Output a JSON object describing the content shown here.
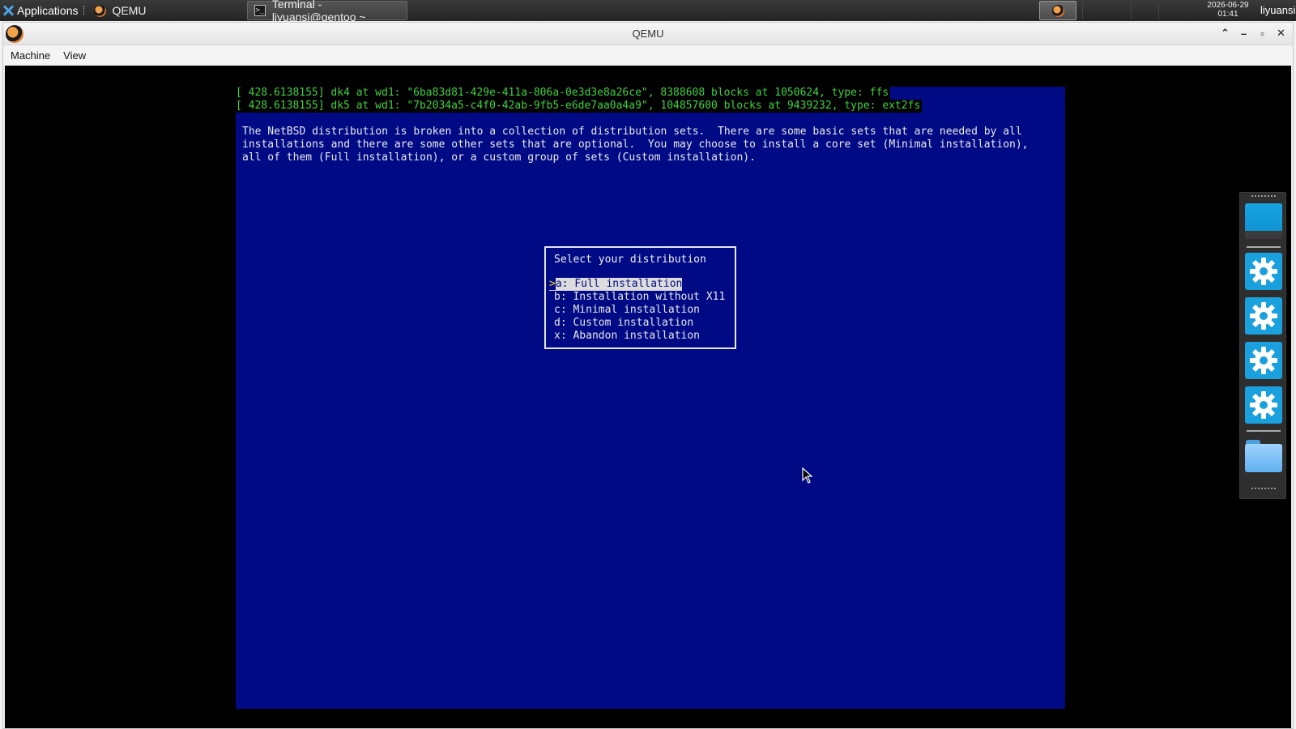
{
  "panel": {
    "applications_label": "Applications",
    "tasks": [
      {
        "label": "QEMU"
      },
      {
        "label": "Terminal - liyuansi@gentoo ~"
      }
    ],
    "clock": {
      "date": "2026-06-29",
      "time": "01:41"
    },
    "user": "liyuansi"
  },
  "window": {
    "title": "QEMU",
    "menu": [
      "Machine",
      "View"
    ]
  },
  "console": {
    "kernel_lines": [
      "[ 428.6138155] dk4 at wd1: \"6ba83d81-429e-411a-806a-0e3d3e8a26ce\", 8388608 blocks at 1050624, type: ffs",
      "[ 428.6138155] dk5 at wd1: \"7b2034a5-c4f0-42ab-9fb5-e6de7aa0a4a9\", 104857600 blocks at 9439232, type: ext2fs"
    ],
    "paragraph": "The NetBSD distribution is broken into a collection of distribution sets.  There are some basic sets that are needed by all\ninstallations and there are some other sets that are optional.  You may choose to install a core set (Minimal installation),\nall of them (Full installation), or a custom group of sets (Custom installation).",
    "menu": {
      "title": "Select your distribution",
      "cursor": ">",
      "items": [
        {
          "label": "a: Full installation",
          "selected": true
        },
        {
          "label": "b: Installation without X11",
          "selected": false
        },
        {
          "label": "c: Minimal installation",
          "selected": false
        },
        {
          "label": "d: Custom installation",
          "selected": false
        },
        {
          "label": "x: Abandon installation",
          "selected": false
        }
      ]
    }
  },
  "dock": {
    "items": [
      "display-icon",
      "gear-icon",
      "gear-icon",
      "gear-icon",
      "gear-icon",
      "folder-icon"
    ]
  },
  "colors": {
    "console_bg": "#000a85",
    "kernel_text": "#3fd23f",
    "highlight": "#dcdcdc",
    "cursor": "#f7e11a"
  }
}
